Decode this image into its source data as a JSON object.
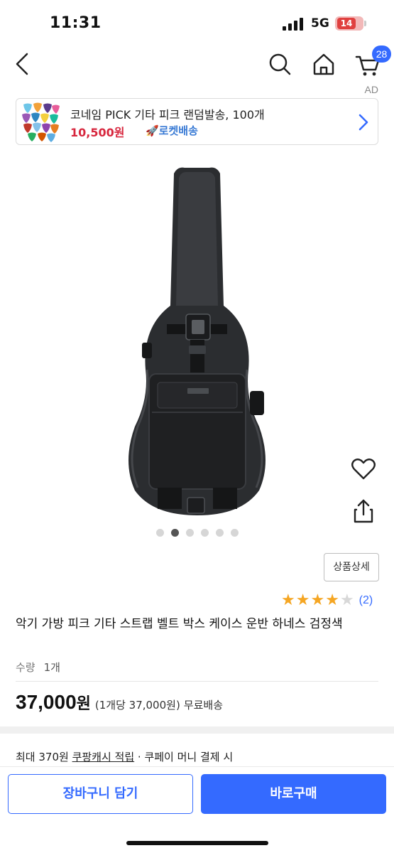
{
  "status_bar": {
    "time": "11:31",
    "network": "5G",
    "battery": "14"
  },
  "nav": {
    "back_icon": "chevron-left-icon",
    "search_icon": "search-icon",
    "home_icon": "home-icon",
    "cart_icon": "cart-icon",
    "cart_count": "28"
  },
  "ad": {
    "label": "AD",
    "title": "코네임 PICK 기타 피크 랜덤발송, 100개",
    "price": "10,500원",
    "delivery": "🚀로켓배송",
    "chevron_icon": "chevron-right-icon"
  },
  "gallery": {
    "total_images": 6,
    "active_index": 1,
    "heart_icon": "heart-icon",
    "share_icon": "share-icon"
  },
  "detail_button_label": "상품상세",
  "rating": {
    "stars": 4,
    "max_stars": 5,
    "review_count": "(2)"
  },
  "product": {
    "title": "악기 가방 피크 기타 스트랩 벨트 박스 케이스 운반 하네스 검정색",
    "quantity_label": "수량",
    "quantity_value": "1개",
    "price": "37,000",
    "price_won": "원",
    "unit_price": "(1개당 37,000원)",
    "shipping": "무료배송"
  },
  "cash": {
    "prefix": "최대 370원 ",
    "link": "쿠팡캐시 적립",
    "suffix": " · 쿠페이 머니 결제 시"
  },
  "actions": {
    "add_to_cart": "장바구니 담기",
    "buy_now": "바로구매"
  },
  "colors": {
    "accent": "#346aff",
    "price_red": "#d7263d",
    "star": "#f5a623"
  }
}
